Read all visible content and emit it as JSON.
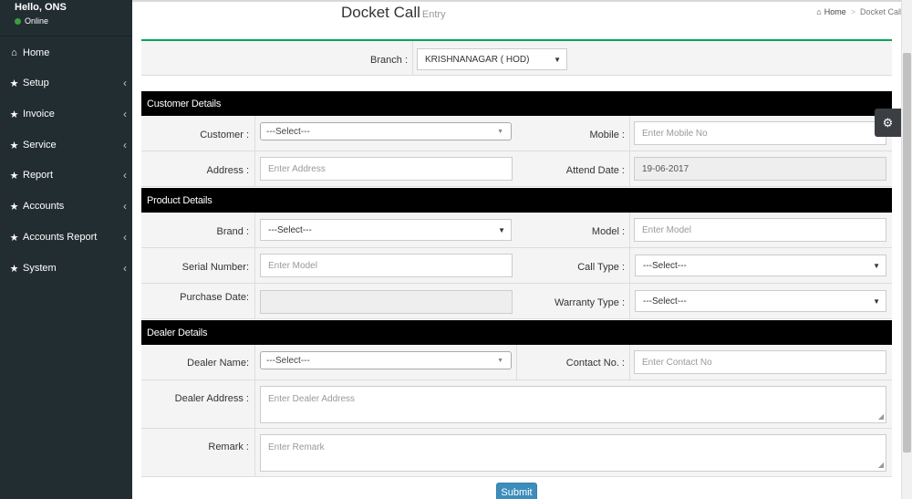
{
  "user": {
    "greeting": "Hello, ONS",
    "status": "Online"
  },
  "sidebar": {
    "items": [
      {
        "label": "Home",
        "icon": "home-icon",
        "has_submenu": false
      },
      {
        "label": "Setup",
        "icon": "star-icon",
        "has_submenu": true
      },
      {
        "label": "Invoice",
        "icon": "star-icon",
        "has_submenu": true
      },
      {
        "label": "Service",
        "icon": "star-icon",
        "has_submenu": true
      },
      {
        "label": "Report",
        "icon": "star-icon",
        "has_submenu": true
      },
      {
        "label": "Accounts",
        "icon": "star-icon",
        "has_submenu": true
      },
      {
        "label": "Accounts Report",
        "icon": "star-icon",
        "has_submenu": true
      },
      {
        "label": "System",
        "icon": "star-icon",
        "has_submenu": true
      }
    ]
  },
  "header": {
    "title": "Docket Call",
    "subtitle": "Entry"
  },
  "breadcrumb": {
    "home": "Home",
    "current": "Docket Call"
  },
  "form": {
    "branch": {
      "label": "Branch :",
      "value": "KRISHNANAGAR ( HOD)"
    },
    "customer_section": "Customer Details",
    "customer": {
      "label": "Customer :",
      "value": "---Select---"
    },
    "mobile": {
      "label": "Mobile :",
      "placeholder": "Enter Mobile No"
    },
    "address": {
      "label": "Address :",
      "placeholder": "Enter Address"
    },
    "attend_date": {
      "label": "Attend Date :",
      "value": "19-06-2017"
    },
    "product_section": "Product Details",
    "brand": {
      "label": "Brand :",
      "value": "---Select---"
    },
    "model": {
      "label": "Model :",
      "placeholder": "Enter Model"
    },
    "serial_number": {
      "label": "Serial Number:",
      "placeholder": "Enter Model"
    },
    "call_type": {
      "label": "Call Type :",
      "value": "---Select---"
    },
    "purchase_date": {
      "label": "Purchase Date:",
      "value": ""
    },
    "warranty_type": {
      "label": "Warranty Type :",
      "value": "---Select---"
    },
    "dealer_section": "Dealer Details",
    "dealer_name": {
      "label": "Dealer Name:",
      "value": "---Select---"
    },
    "contact_no": {
      "label": "Contact No. :",
      "placeholder": "Enter Contact No"
    },
    "dealer_address": {
      "label": "Dealer Address :",
      "placeholder": "Enter Dealer Address"
    },
    "remark": {
      "label": "Remark :",
      "placeholder": "Enter Remark"
    },
    "submit_label": "Submit"
  },
  "colors": {
    "sidebar_bg": "#222d32",
    "accent_green": "#00a65a",
    "button_blue": "#3c8dbc",
    "section_bar": "#000000"
  }
}
